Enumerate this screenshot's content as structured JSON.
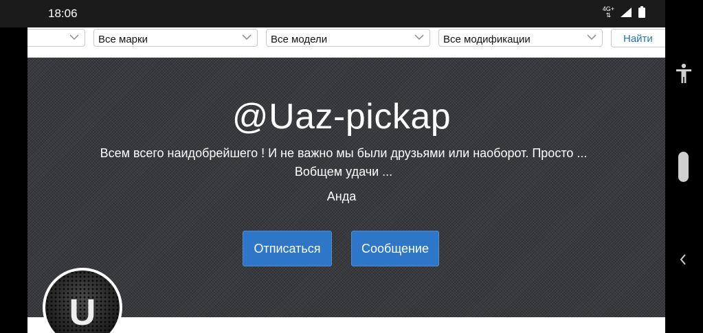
{
  "status_bar": {
    "time": "18:06",
    "network": "4G+"
  },
  "filters": {
    "region": "",
    "brand": "Все марки",
    "model": "Все модели",
    "modification": "Все модификации",
    "find_label": "Найти"
  },
  "profile": {
    "username": "@Uaz-pickap",
    "description_line1": "Всем всего наидобрейшего ! И не важно мы были друзьями или наоборот. Просто ...",
    "description_line2": "Вобщем удачи ...",
    "name": "Анда",
    "unsubscribe_label": "Отписаться",
    "message_label": "Сообщение",
    "avatar_letter": "U"
  },
  "colors": {
    "accent": "#2e77c8",
    "link": "#1e73c8"
  },
  "icons": {
    "accessibility": "accessibility-icon",
    "back": "chevron-left-icon",
    "signal": "signal-icon",
    "battery": "battery-icon"
  }
}
